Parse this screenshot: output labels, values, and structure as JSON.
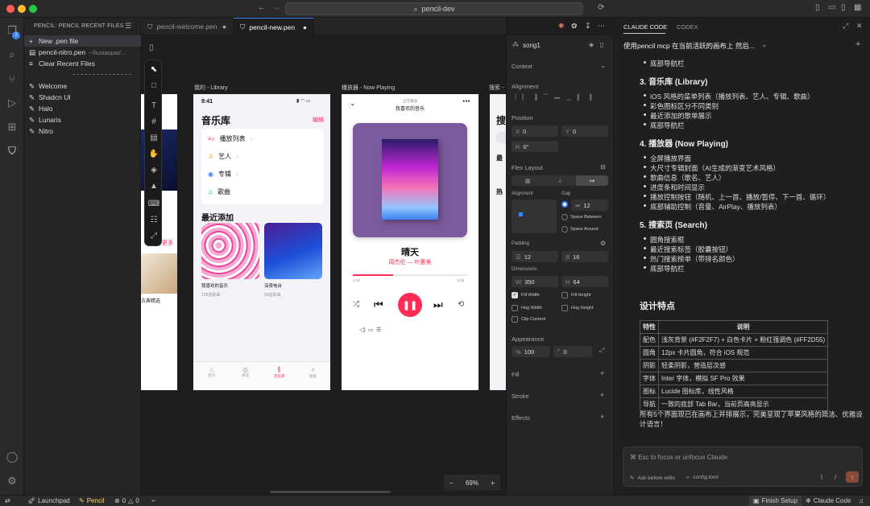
{
  "window": {
    "search": "pencil-dev"
  },
  "activity": {
    "badge": "2"
  },
  "sidebar": {
    "title": "PENCIL: PENCIL RECENT FILES",
    "new_file": "New .pen file",
    "recent": "pencil-nitro.pen",
    "recent_path": "~/liuxiaopai/...",
    "clear": "Clear Recent Files",
    "themes": [
      "Welcome",
      "Shadcn UI",
      "Halo",
      "Lunaris",
      "Nitro"
    ]
  },
  "tabs": [
    {
      "label": "pencil-welcome.pen"
    },
    {
      "label": "pencil-new.pen"
    }
  ],
  "canvas": {
    "frame_library_label": "我的 - Library",
    "frame_player_label": "播放器 - Now Playing",
    "frame_search_label": "搜索 -",
    "left_frame": {
      "more": "更多",
      "caption": "古典精选"
    },
    "library": {
      "time": "9:41",
      "title": "音乐库",
      "edit": "编辑",
      "menu": [
        "播放列表",
        "艺人",
        "专辑",
        "歌曲"
      ],
      "recent_title": "最近添加",
      "cards": [
        {
          "name": "我喜欢的音乐",
          "count": "128首歌曲"
        },
        {
          "name": "深夜电台",
          "count": "56首歌曲"
        }
      ],
      "tabbar": [
        "首页",
        "发现",
        "音乐库",
        "搜索"
      ]
    },
    "player": {
      "header_top": "正在播放",
      "header": "我喜欢的音乐",
      "song": "晴天",
      "artist": "周杰伦 — 叶惠美",
      "elapsed": "1:24",
      "remaining": "-3:15",
      "progress": 0.35
    },
    "search_frame": {
      "title": "搜",
      "recent": "最",
      "hot": "热"
    },
    "zoom": "69%"
  },
  "props": {
    "layer": "song1",
    "context": "Context",
    "alignment": "Alignment",
    "position": "Position",
    "x": "0",
    "y": "0",
    "r": "0°",
    "flex_layout": "Flex Layout",
    "align_label": "Alignment",
    "gap_label": "Gap",
    "gap": "12",
    "space_between": "Space Between",
    "space_around": "Space Around",
    "padding": "Padding",
    "pad_v": "12",
    "pad_h": "16",
    "dimensions": "Dimensions",
    "w": "350",
    "h": "64",
    "fill_width": "Fill Width",
    "fill_height": "Fill Height",
    "hug_width": "Hug Width",
    "hug_height": "Hug Height",
    "clip": "Clip Content",
    "appearance": "Appearance",
    "opacity": "100",
    "radius": "0",
    "fill": "Fill",
    "stroke": "Stroke",
    "effects": "Effects"
  },
  "claude": {
    "tab1": "CLAUDE CODE",
    "tab2": "CODEX",
    "session": "使用pencil mcp 在当前活跃的画布上 然后...",
    "lines": [
      {
        "type": "li",
        "text": "底部导航栏"
      },
      {
        "type": "h",
        "text": "3. 音乐库 (Library)"
      },
      {
        "type": "li",
        "text": "iOS 风格的菜单列表（播放列表、艺人、专辑、歌曲）"
      },
      {
        "type": "li",
        "text": "彩色图标区分不同类别"
      },
      {
        "type": "li",
        "text": "最近添加的歌单展示"
      },
      {
        "type": "li",
        "text": "底部导航栏"
      },
      {
        "type": "h",
        "text": "4. 播放器 (Now Playing)"
      },
      {
        "type": "li",
        "text": "全屏播放界面"
      },
      {
        "type": "li",
        "text": "大尺寸专辑封面（AI生成的渐变艺术风格）"
      },
      {
        "type": "li",
        "text": "歌曲信息（歌名、艺人）"
      },
      {
        "type": "li",
        "text": "进度条和时间显示"
      },
      {
        "type": "li",
        "text": "播放控制按钮（随机、上一首、播放/暂停、下一首、循环）"
      },
      {
        "type": "li",
        "text": "底部辅助控制（音量、AirPlay、播放列表）"
      },
      {
        "type": "h",
        "text": "5. 搜索页 (Search)"
      },
      {
        "type": "li",
        "text": "圆角搜索框"
      },
      {
        "type": "li",
        "text": "最近搜索标签（胶囊按钮）"
      },
      {
        "type": "li",
        "text": "热门搜索榜单（带排名颜色）"
      },
      {
        "type": "li",
        "text": "底部导航栏"
      }
    ],
    "design_title": "设计特点",
    "table_head": [
      "特性",
      "说明"
    ],
    "table_rows": [
      [
        "配色",
        "浅灰背景 (#F2F2F7) + 白色卡片 + 粉红强调色 (#FF2D55)"
      ],
      [
        "圆角",
        "12px 卡片圆角，符合 iOS 规范"
      ],
      [
        "阴影",
        "轻柔阴影，营造层次感"
      ],
      [
        "字体",
        "Inter 字体，模拟 SF Pro 效果"
      ],
      [
        "图标",
        "Lucide 图标库，线性风格"
      ],
      [
        "导航",
        "一致的底部 Tab Bar，当前页高亮显示"
      ]
    ],
    "summary_1": "所有5个界面现已在画布上并排展示，完美呈现了苹果风格的简洁、优雅设",
    "summary_2": "计语言！",
    "input_placeholder": "⌘ Esc to focus or unfocus Claude",
    "ask_before_edits": "Ask before edits",
    "config": "config.toml"
  },
  "status": {
    "launchpad": "Launchpad",
    "pencil": "Pencil",
    "errors": "0",
    "warnings": "0",
    "finish_setup": "Finish Setup",
    "claude_code": "Claude Code"
  },
  "colors": {
    "accent": "#FF2D55",
    "blue": "#3b82f6",
    "brand_orange": "#e07a5f"
  }
}
